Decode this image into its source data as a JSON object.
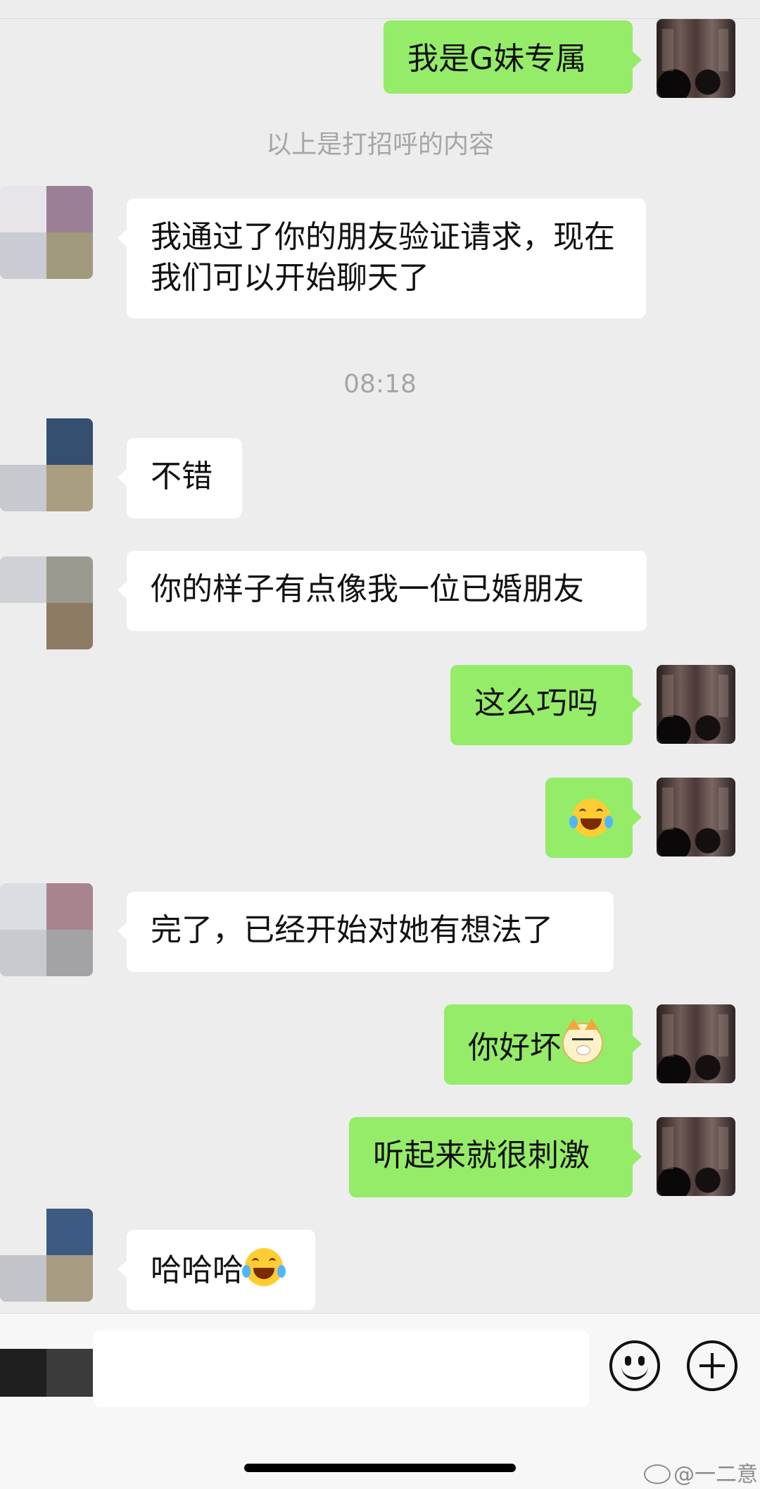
{
  "messages": {
    "m1": "我是G妹专属",
    "sys1": "以上是打招呼的内容",
    "m2": "我通过了你的朋友验证请求，现在我们可以开始聊天了",
    "time1": "08:18",
    "m3": "不错",
    "m4": "你的样子有点像我一位已婚朋友",
    "m5": "这么巧吗",
    "m7": "完了，已经开始对她有想法了",
    "m8": "你好坏",
    "m9": "听起来就很刺激",
    "m10": "哈哈哈"
  },
  "icons": {
    "laugh": "face-with-tears-of-joy-icon",
    "dog": "doge-icon"
  },
  "input": {
    "value": "",
    "placeholder": ""
  },
  "watermark": "@一二意",
  "colors": {
    "background": "#ededed",
    "sent_bubble": "#95ec69",
    "received_bubble": "#ffffff",
    "system_text": "#a6a6a6"
  }
}
